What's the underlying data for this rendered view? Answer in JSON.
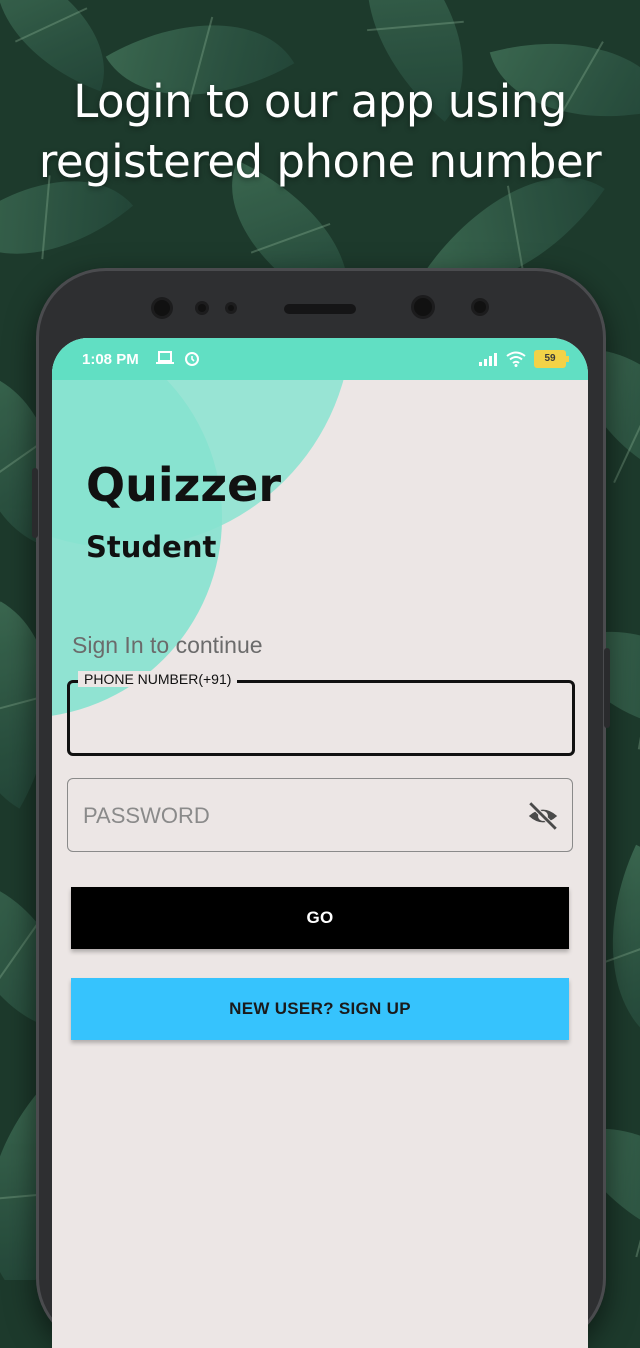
{
  "promo": {
    "line1": "Login to our app using",
    "line2": "registered phone number"
  },
  "statusbar": {
    "time": "1:08 PM",
    "battery": "59",
    "icons": [
      "laptop-icon",
      "alarm-icon",
      "signal-icon",
      "wifi-icon",
      "battery-icon"
    ]
  },
  "app": {
    "title": "Quizzer",
    "subtitle": "Student",
    "signin_text": "Sign In to continue"
  },
  "form": {
    "phone_label": "PHONE NUMBER(+91)",
    "phone_value": "",
    "password_placeholder": "PASSWORD",
    "password_value": ""
  },
  "buttons": {
    "go": "GO",
    "signup": "NEW USER? SIGN UP"
  },
  "colors": {
    "accent_teal": "#61dfc3",
    "signup_blue": "#36c3fd",
    "go_black": "#000000",
    "screen_bg": "#ece6e5"
  }
}
